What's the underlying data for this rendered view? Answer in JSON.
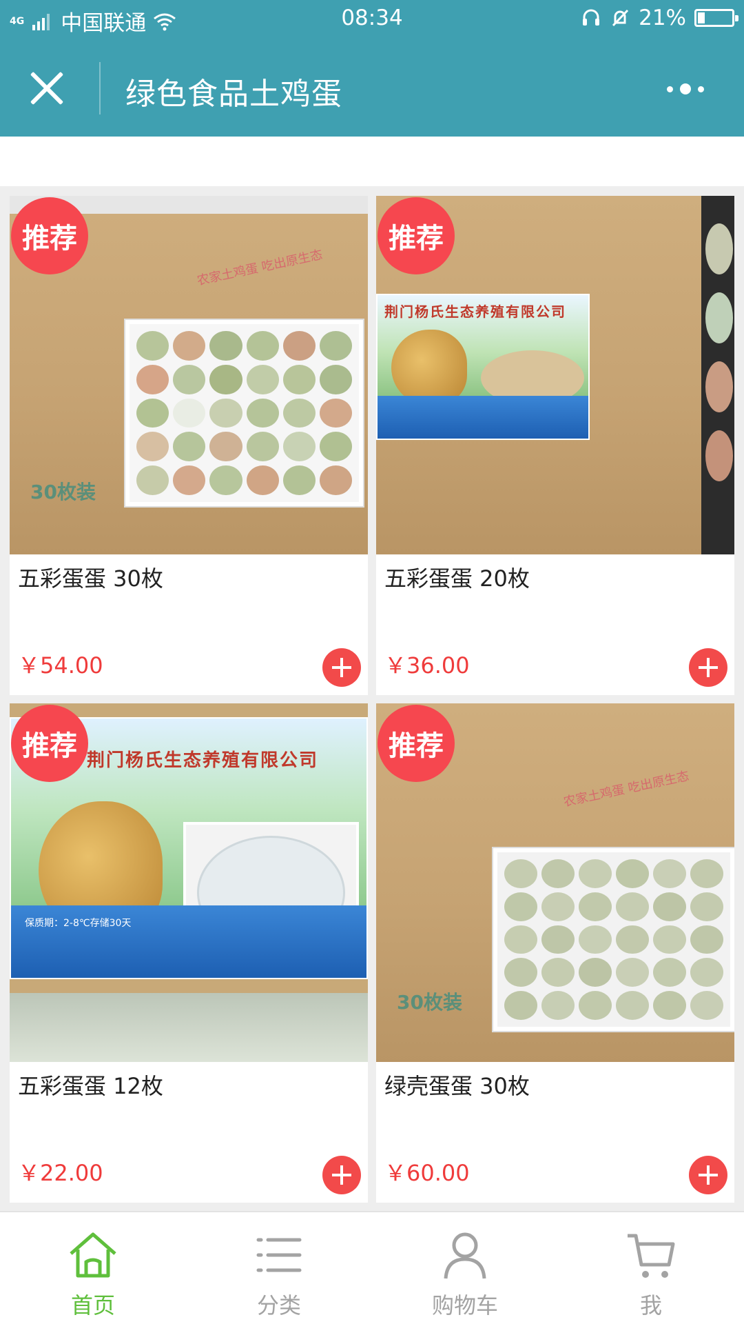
{
  "status_bar": {
    "network": "4G",
    "carrier": "中国联通",
    "time": "08:34",
    "battery": "21%",
    "battery_level": 0.21
  },
  "header": {
    "title": "绿色食品土鸡蛋"
  },
  "colors": {
    "header_bg": "#3fa0b1",
    "badge": "#f6474f",
    "price": "#ef3b3b",
    "tab_active": "#5fbf3c",
    "tab_inactive": "#a3a3a3"
  },
  "products": [
    {
      "badge": "推荐",
      "name": "五彩蛋蛋 30枚",
      "price": "￥54.00",
      "box_print": "农家土鸡蛋 吃出原生态",
      "box_label": "30枚装"
    },
    {
      "badge": "推荐",
      "name": "五彩蛋蛋 20枚",
      "price": "￥36.00",
      "banner_title": "荆门杨氏生态养殖有限公司"
    },
    {
      "badge": "推荐",
      "name": "五彩蛋蛋 12枚",
      "price": "￥22.00",
      "banner_title": "荆门杨氏生态养殖有限公司",
      "banner_text": "保质期：2-8℃存储30天"
    },
    {
      "badge": "推荐",
      "name": "绿壳蛋蛋 30枚",
      "price": "￥60.00",
      "box_print": "农家土鸡蛋 吃出原生态",
      "box_label": "30枚装"
    }
  ],
  "tabs": [
    {
      "label": "首页",
      "icon": "home-icon",
      "active": true
    },
    {
      "label": "分类",
      "icon": "list-icon",
      "active": false
    },
    {
      "label": "购物车",
      "icon": "person-icon",
      "active": false
    },
    {
      "label": "我",
      "icon": "cart-icon",
      "active": false
    }
  ]
}
